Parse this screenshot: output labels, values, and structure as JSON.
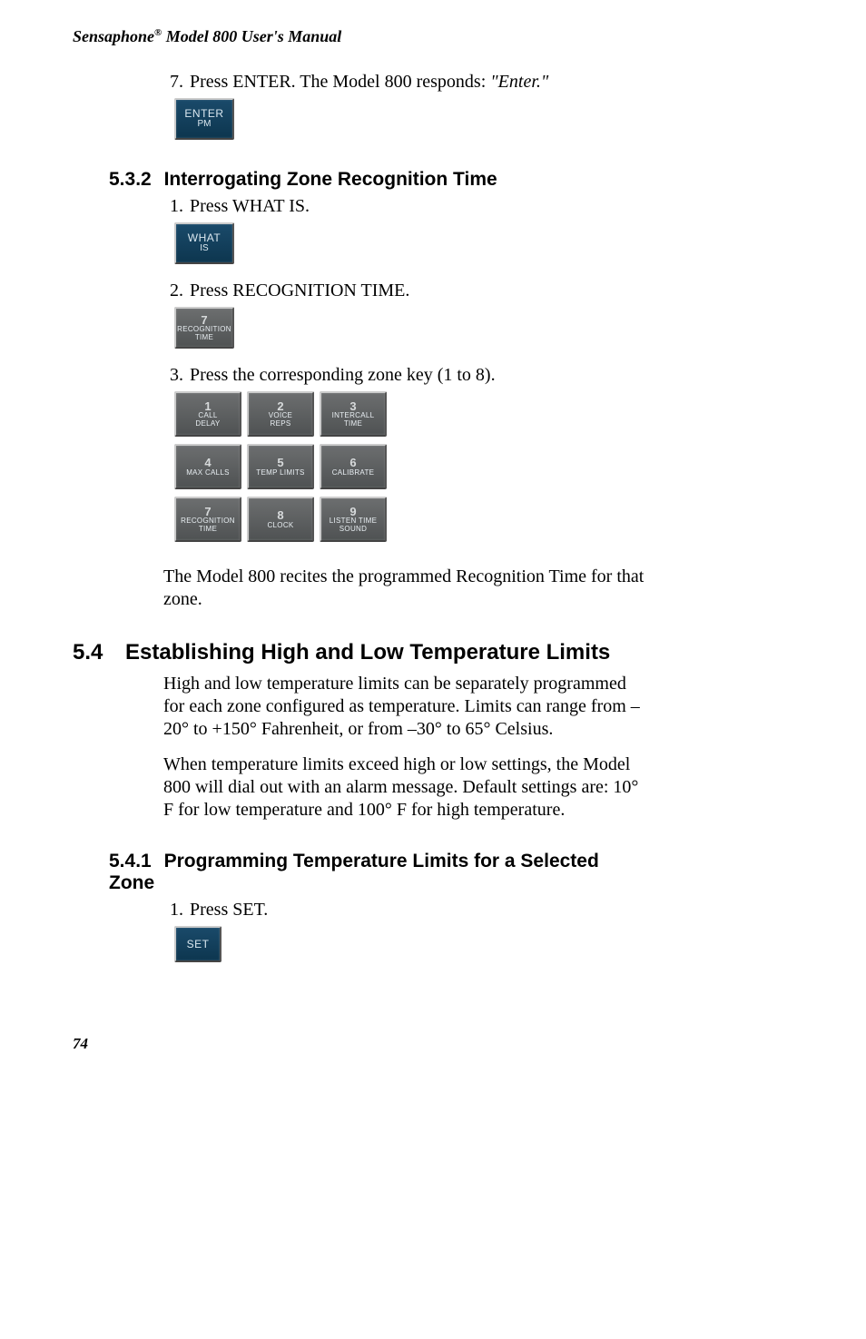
{
  "header": {
    "brand": "Sensaphone",
    "reg": "®",
    "subtitle": "Model 800 User's Manual"
  },
  "step7": {
    "num": "7.",
    "text_a": "Press ENTER. The Model 800 responds: ",
    "quoted": "\"Enter.\"",
    "key": {
      "line1": "ENTER",
      "line2": "PM"
    }
  },
  "sec532": {
    "num": "5.3.2",
    "title": "Interrogating Zone Recognition Time",
    "s1": {
      "num": "1.",
      "text": "Press WHAT IS.",
      "key": {
        "line1": "WHAT",
        "line2": "IS"
      }
    },
    "s2": {
      "num": "2.",
      "text": "Press RECOGNITION TIME.",
      "key": {
        "num": "7",
        "l1": "RECOGNITION",
        "l2": "TIME"
      }
    },
    "s3": {
      "num": "3.",
      "text": "Press the corresponding zone key (1 to 8).",
      "keypad": {
        "k1": {
          "n": "1",
          "a": "CALL",
          "b": "DELAY"
        },
        "k2": {
          "n": "2",
          "a": "VOICE",
          "b": "REPS"
        },
        "k3": {
          "n": "3",
          "a": "INTERCALL",
          "b": "TIME"
        },
        "k4": {
          "n": "4",
          "a": "MAX CALLS"
        },
        "k5": {
          "n": "5",
          "a": "TEMP LIMITS"
        },
        "k6": {
          "n": "6",
          "a": "CALIBRATE"
        },
        "k7": {
          "n": "7",
          "a": "RECOGNITION",
          "b": "TIME"
        },
        "k8": {
          "n": "8",
          "a": "CLOCK"
        },
        "k9": {
          "n": "9",
          "a": "LISTEN TIME",
          "b": "SOUND"
        }
      }
    },
    "tail": "The Model 800 recites the programmed Recognition Time for that zone."
  },
  "sec54": {
    "num": "5.4",
    "title": "Establishing High and Low Temperature Limits",
    "p1": "High and low temperature limits can be separately programmed for each zone configured as temperature. Limits can range from –20° to +150° Fahrenheit, or from –30° to 65° Celsius.",
    "p2": "When temperature limits exceed high or low settings, the Model 800 will dial out with an alarm message. Default settings are: 10° F for low temperature and 100° F for high temperature."
  },
  "sec541": {
    "num": "5.4.1",
    "title": "Programming Temperature Limits for a Selected Zone",
    "s1": {
      "num": "1.",
      "text": "Press SET.",
      "key": {
        "line1": "SET"
      }
    }
  },
  "page": "74"
}
